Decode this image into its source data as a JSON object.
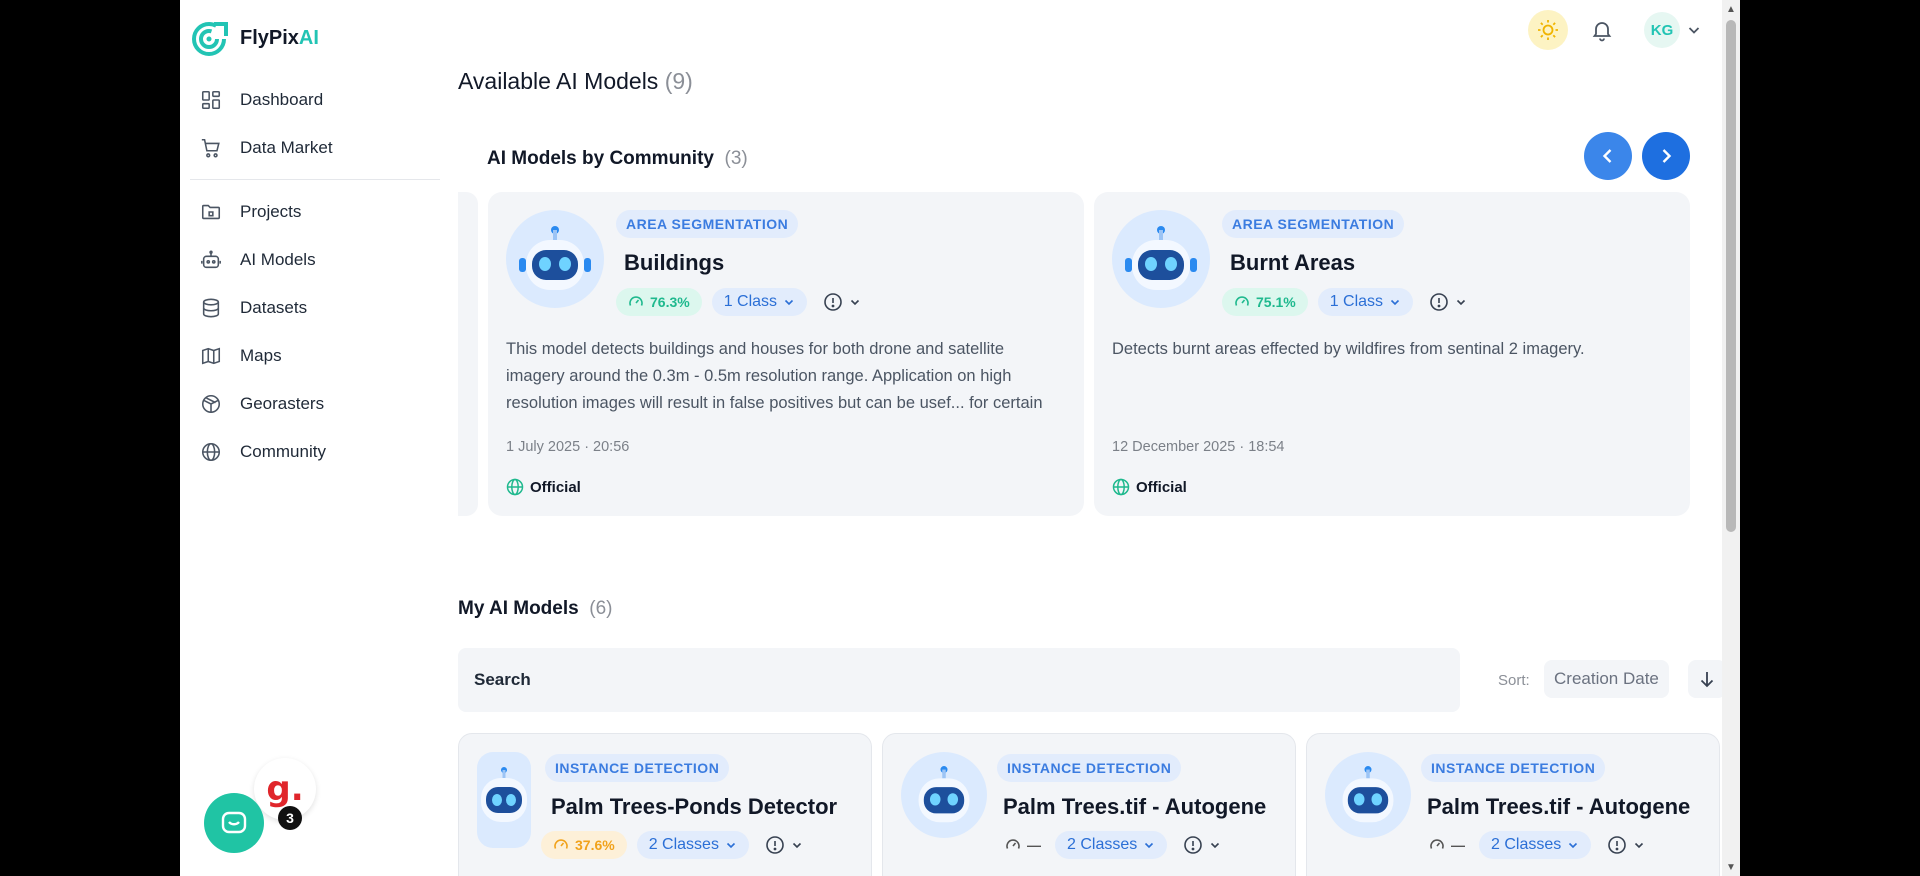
{
  "brand": {
    "name_main": "FlyPix",
    "name_accent": "AI"
  },
  "sidebar": {
    "group1": [
      {
        "label": "Dashboard",
        "icon": "dashboard-icon"
      },
      {
        "label": "Data Market",
        "icon": "cart-icon"
      }
    ],
    "group2": [
      {
        "label": "Projects",
        "icon": "folder-icon"
      },
      {
        "label": "AI Models",
        "icon": "robot-icon"
      },
      {
        "label": "Datasets",
        "icon": "database-icon"
      },
      {
        "label": "Maps",
        "icon": "map-icon"
      },
      {
        "label": "Georasters",
        "icon": "globe-grid-icon"
      },
      {
        "label": "Community",
        "icon": "globe-icon"
      }
    ]
  },
  "chat": {
    "unread": "3",
    "g_logo": "g."
  },
  "topbar": {
    "avatar_initials": "KG"
  },
  "main": {
    "title": "Available AI Models",
    "title_count": "(9)",
    "community": {
      "title": "AI Models by Community",
      "count": "(3)",
      "cards": [
        {
          "tag": "AREA SEGMENTATION",
          "name": "Buildings",
          "accuracy": "76.3%",
          "classes": "1 Class",
          "description": "This model detects buildings and houses for both drone and satellite imagery around the 0.3m - 0.5m resolution range. Application on high resolution images will result in false positives but can be usef... for certain usecases. Sheds, roofs and buildings can be separated.",
          "date": "1 July 2025 · 20:56",
          "source": "Official"
        },
        {
          "tag": "AREA SEGMENTATION",
          "name": "Burnt Areas",
          "accuracy": "75.1%",
          "classes": "1 Class",
          "description": "Detects burnt areas effected by wildfires from sentinal 2 imagery.",
          "date": "12 December 2025 · 18:54",
          "source": "Official"
        }
      ]
    },
    "my_models": {
      "title": "My AI Models",
      "count": "(6)",
      "search_label": "Search",
      "sort_label": "Sort:",
      "sort_value": "Creation Date",
      "cards": [
        {
          "tag": "INSTANCE DETECTION",
          "name": "Palm Trees-Ponds Detector",
          "accuracy": "37.6%",
          "classes": "2 Classes"
        },
        {
          "tag": "INSTANCE DETECTION",
          "name": "Palm Trees.tif - Autogene",
          "accuracy": "—",
          "classes": "2 Classes"
        },
        {
          "tag": "INSTANCE DETECTION",
          "name": "Palm Trees.tif - Autogene",
          "accuracy": "—",
          "classes": "2 Classes"
        }
      ]
    }
  },
  "colors": {
    "brand_teal": "#22c4b4",
    "primary_blue": "#1e6fe0",
    "accuracy_green": "#1fb98e",
    "accuracy_warn": "#f1a21b"
  }
}
